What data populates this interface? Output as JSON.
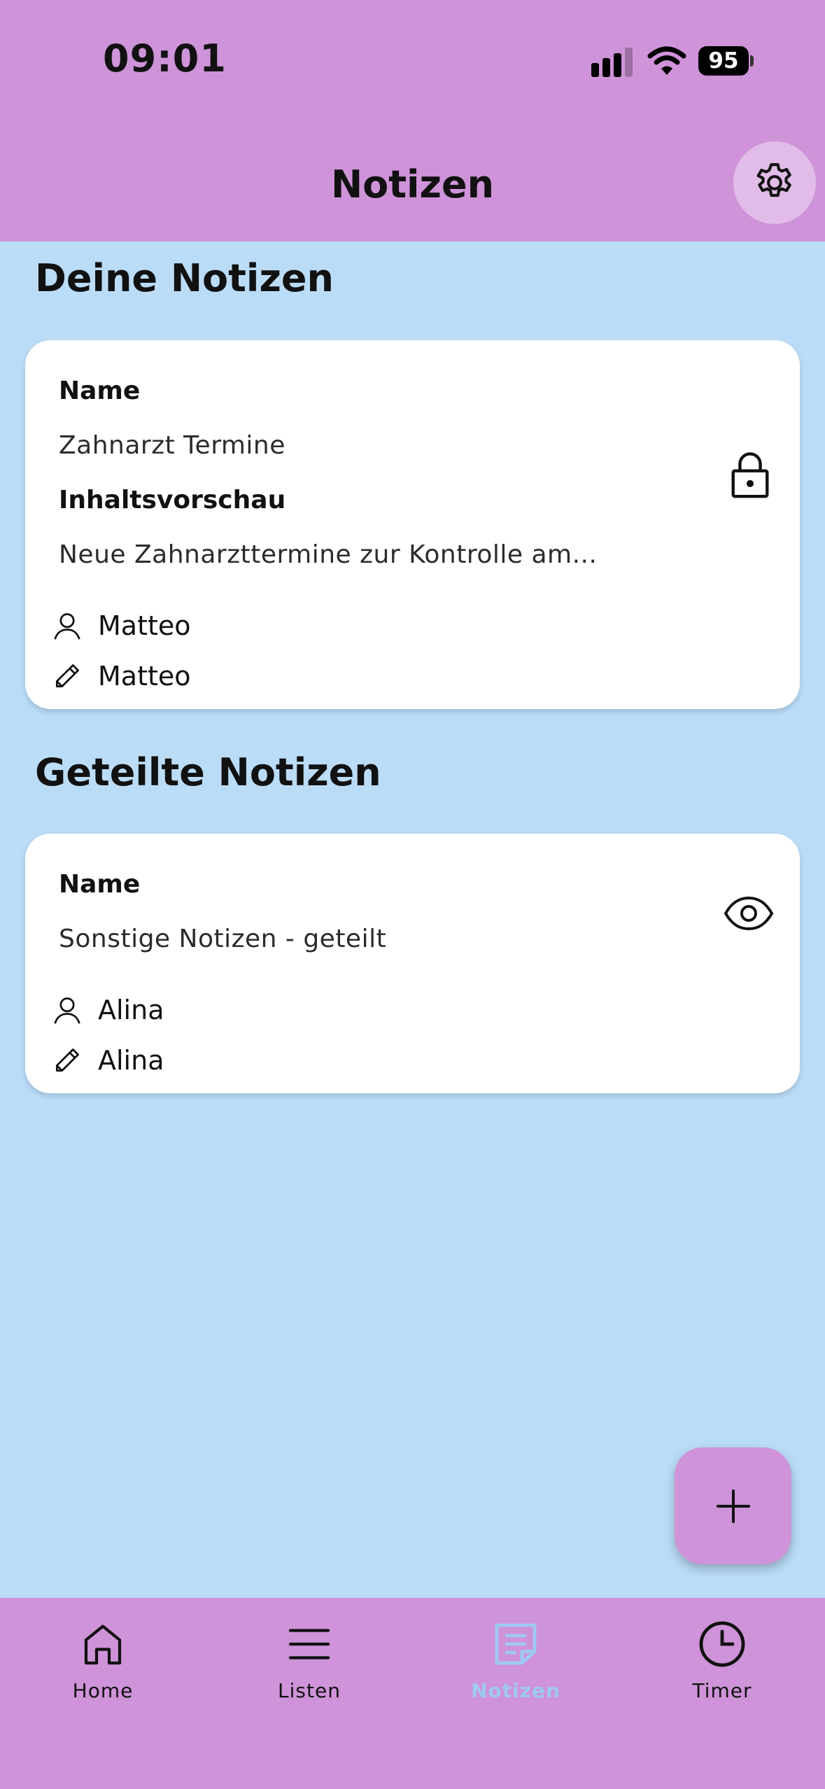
{
  "status_bar": {
    "time": "09:01",
    "battery": "95"
  },
  "header": {
    "title": "Notizen"
  },
  "sections": {
    "own": {
      "title": "Deine Notizen"
    },
    "shared": {
      "title": "Geteilte Notizen"
    }
  },
  "own_note": {
    "name_label": "Name",
    "name": "Zahnarzt Termine",
    "preview_label": "Inhaltsvorschau",
    "preview": "Neue Zahnarzttermine zur Kontrolle am...",
    "owner": "Matteo",
    "editor": "Matteo",
    "access_icon": "lock-icon"
  },
  "shared_note": {
    "name_label": "Name",
    "name": "Sonstige Notizen - geteilt",
    "owner": "Alina",
    "editor": "Alina",
    "access_icon": "eye-icon"
  },
  "fab": {
    "label": "+"
  },
  "bottom_nav": {
    "items": [
      {
        "label": "Home",
        "icon": "home-icon"
      },
      {
        "label": "Listen",
        "icon": "list-icon"
      },
      {
        "label": "Notizen",
        "icon": "note-icon",
        "active": true
      },
      {
        "label": "Timer",
        "icon": "clock-icon"
      }
    ]
  },
  "colors": {
    "bar": "#cf93d9",
    "background": "#badcf7",
    "active": "#9ec9f3",
    "card": "#ffffff"
  }
}
